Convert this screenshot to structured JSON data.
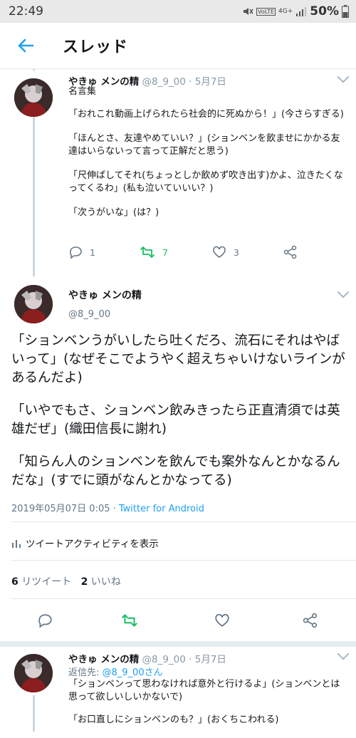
{
  "status_bar": {
    "time": "22:49",
    "network_badge": "VoLTE",
    "signal": "4G+",
    "battery": "50%"
  },
  "app_bar": {
    "title": "スレッド",
    "back_icon": "back-arrow-icon"
  },
  "tweets": [
    {
      "name": "やきゅ メンの精",
      "handle": "@8_9_00",
      "date": "· 5月7日",
      "lines": [
        "名言集",
        "「おれこれ動画上げられたら社会的に死ぬから！」(今さらすぎる)",
        "「ほんとさ、友達やめていい？」(ションベンを飲ませにかかる友達はいらないって言って正解だと思う)",
        "「尺伸ばしてそれ(ちょっとしか飲めず吹き出す)かよ、泣きたくなってくるわ」(私も泣いていいい？)",
        "「次うがいな」(は？)"
      ],
      "replies": "1",
      "retweets": "7",
      "likes": "3"
    }
  ],
  "focus": {
    "name": "やきゅ メンの精",
    "handle": "@8_9_00",
    "paragraphs": [
      "「ションベンうがいしたら吐くだろ、流石にそれはやばいって」(なぜそこでようやく超えちゃいけないラインがあるんだよ)",
      "「いやでもさ、ションベン飲みきったら正直清須では英雄だぜ」(織田信長に謝れ)",
      "「知らん人のションベンを飲んでも案外なんとかなるんだな」(すでに頭がなんとかなってる)"
    ],
    "datetime": "2019年05月07日 0:05 · ",
    "source": "Twitter for Android",
    "activity_label": "ツイートアクティビティを表示",
    "retweet_count": "6",
    "retweet_label": "リツイート",
    "like_count": "2",
    "like_label": "いいね"
  },
  "reply": {
    "name": "やきゅ メンの精",
    "handle": "@8_9_00",
    "date": "· 5月7日",
    "reply_to_label": "返信先: ",
    "reply_to_handle": "@8_9_00さん",
    "lines": [
      "「ションベンって思わなければ意外と行けるよ」(ションベンとは思って欲しいしいかないで)",
      "「お口直しにションベンのも？」(おくちこわれる)"
    ]
  },
  "colors": {
    "accent": "#1da1f2",
    "retweet_green": "#17bf63",
    "muted": "#657786"
  }
}
